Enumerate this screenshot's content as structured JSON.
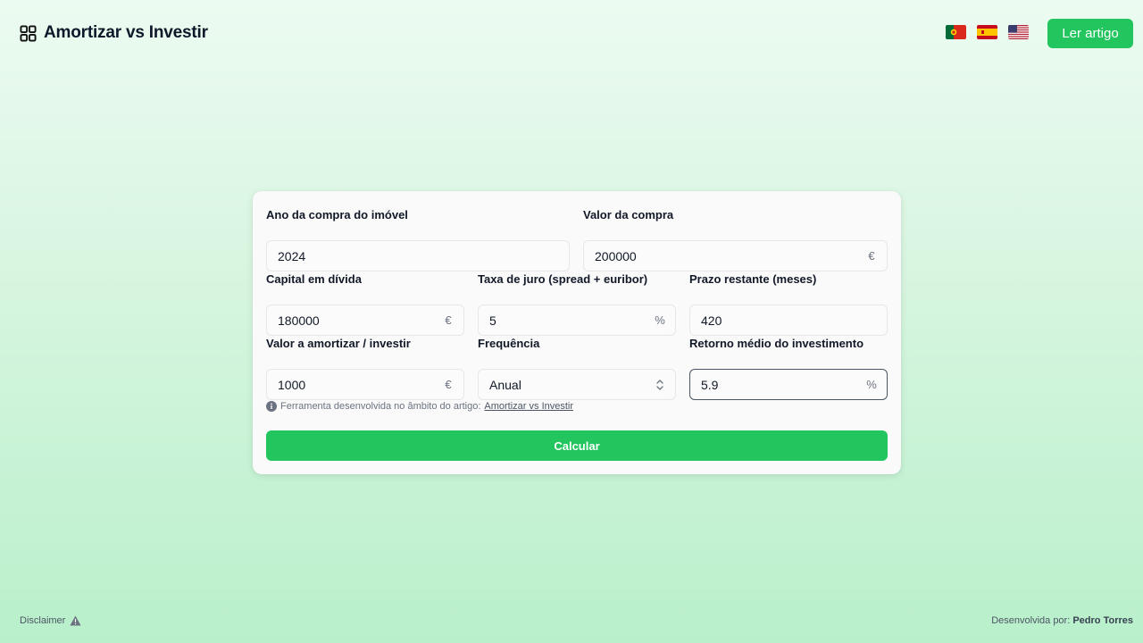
{
  "header": {
    "title": "Amortizar vs Investir",
    "logo_icon": "grid-icon",
    "flags": [
      "portugal-flag",
      "spain-flag",
      "usa-flag"
    ],
    "article_button": "Ler artigo"
  },
  "form": {
    "purchase_year": {
      "label": "Ano da compra do imóvel",
      "value": "2024"
    },
    "purchase_value": {
      "label": "Valor da compra",
      "value": "200000",
      "suffix": "€"
    },
    "debt_capital": {
      "label": "Capital em dívida",
      "value": "180000",
      "suffix": "€"
    },
    "interest_rate": {
      "label": "Taxa de juro (spread + euribor)",
      "value": "5",
      "suffix": "%"
    },
    "remaining_term": {
      "label": "Prazo restante (meses)",
      "value": "420"
    },
    "amount": {
      "label": "Valor a amortizar / investir",
      "value": "1000",
      "suffix": "€"
    },
    "frequency": {
      "label": "Frequência",
      "value": "Anual"
    },
    "investment_return": {
      "label": "Retorno médio do investimento",
      "value": "5.9",
      "suffix": "%"
    },
    "info_text": "Ferramenta desenvolvida no âmbito do artigo:",
    "info_link": "Amortizar vs Investir",
    "submit": "Calcular"
  },
  "footer": {
    "disclaimer": "Disclaimer",
    "credit_prefix": "Desenvolvida por:",
    "credit_name": "Pedro Torres"
  },
  "colors": {
    "accent": "#22c55e",
    "background": "#d6f5df"
  }
}
